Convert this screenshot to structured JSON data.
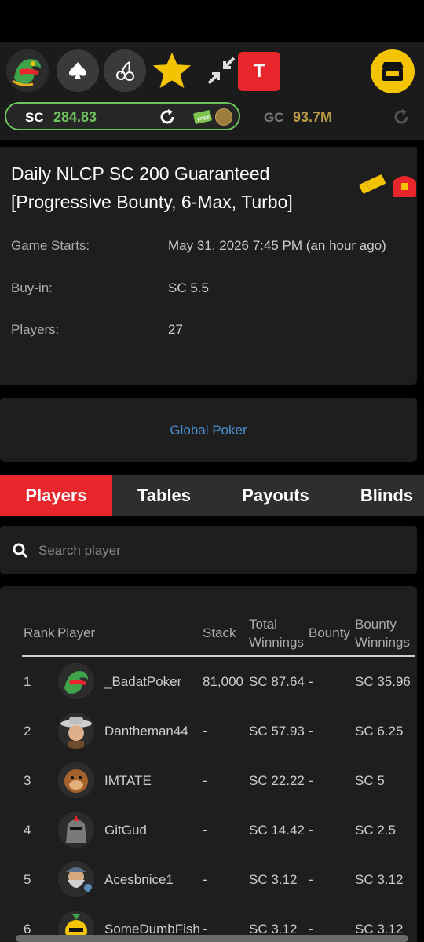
{
  "topbar": {
    "icons": [
      "dragon-avatar-icon",
      "spade-icon",
      "cherry-icon",
      "star-icon",
      "shrink-arrows-icon",
      "store-icon"
    ],
    "t_button": "T",
    "sc_label": "SC",
    "sc_value": "284.83",
    "free_badge": "FREE",
    "gc_label": "GC",
    "gc_value": "93.7M",
    "colors": {
      "accent_red": "#e8262c",
      "sc_green": "#6ec25c",
      "gc_gold": "#b99a45",
      "store_yellow": "#f4c400"
    }
  },
  "tournament": {
    "title": "Daily NLCP SC 200 Guaranteed [Progressive Bounty, 6-Max, Turbo]",
    "rows": [
      {
        "label": "Game Starts:",
        "value": "May 31, 2026 7:45 PM (an hour ago)"
      },
      {
        "label": "Buy-in:",
        "value": "SC 5.5"
      },
      {
        "label": "Players:",
        "value": "27"
      }
    ]
  },
  "venue": {
    "link": "Global Poker"
  },
  "tabs": [
    "Players",
    "Tables",
    "Payouts",
    "Blinds"
  ],
  "active_tab": "Players",
  "search": {
    "placeholder": "Search player"
  },
  "players_table": {
    "headers": [
      "Rank",
      "Player",
      "Stack",
      "Total Winnings",
      "Bounty",
      "Bounty Winnings"
    ],
    "rows": [
      {
        "rank": "1",
        "player": "_BadatPoker",
        "stack": "81,000",
        "total": "SC 87.64",
        "bounty": "-",
        "bounty_winnings": "SC 35.96",
        "avatar": "dragon-avatar-icon"
      },
      {
        "rank": "2",
        "player": "Dantheman44",
        "stack": "-",
        "total": "SC 57.93",
        "bounty": "-",
        "bounty_winnings": "SC 6.25",
        "avatar": "cowboy-avatar-icon"
      },
      {
        "rank": "3",
        "player": "IMTATE",
        "stack": "-",
        "total": "SC 22.22",
        "bounty": "-",
        "bounty_winnings": "SC 5",
        "avatar": "monkey-avatar-icon"
      },
      {
        "rank": "4",
        "player": "GitGud",
        "stack": "-",
        "total": "SC 14.42",
        "bounty": "-",
        "bounty_winnings": "SC 2.5",
        "avatar": "knight-avatar-icon"
      },
      {
        "rank": "5",
        "player": "Acesbnice1",
        "stack": "-",
        "total": "SC 3.12",
        "bounty": "-",
        "bounty_winnings": "SC 3.12",
        "avatar": "wizard-avatar-icon"
      },
      {
        "rank": "6",
        "player": "SomeDumbFish",
        "stack": "-",
        "total": "SC 3.12",
        "bounty": "-",
        "bounty_winnings": "SC 3.12",
        "avatar": "fish-avatar-icon"
      }
    ]
  }
}
